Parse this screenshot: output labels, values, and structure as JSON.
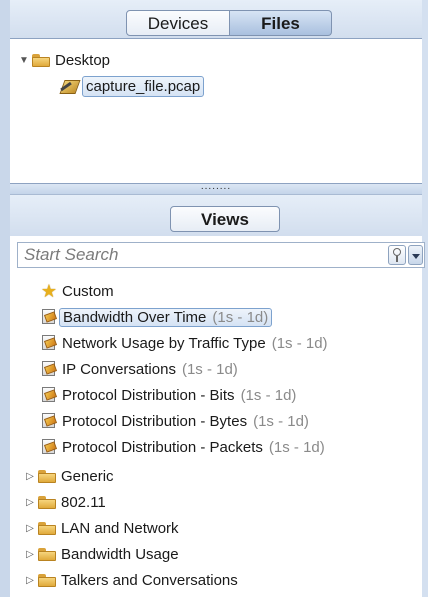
{
  "top_tabs": {
    "devices_label": "Devices",
    "files_label": "Files",
    "active": "Files"
  },
  "files_tree": {
    "root_label": "Desktop",
    "file_label": "capture_file.pcap"
  },
  "splitter": {
    "grip": "........"
  },
  "views": {
    "tab_label": "Views",
    "search": {
      "placeholder": "Start Search"
    },
    "custom_label": "Custom",
    "items": [
      {
        "label": "Bandwidth Over Time",
        "range": "(1s - 1d)",
        "selected": true
      },
      {
        "label": "Network Usage by Traffic Type",
        "range": "(1s - 1d)"
      },
      {
        "label": "IP Conversations",
        "range": "(1s - 1d)"
      },
      {
        "label": "Protocol Distribution - Bits",
        "range": "(1s - 1d)"
      },
      {
        "label": "Protocol Distribution - Bytes",
        "range": "(1s - 1d)"
      },
      {
        "label": "Protocol Distribution - Packets",
        "range": "(1s - 1d)"
      }
    ],
    "folders": [
      {
        "label": "Generic"
      },
      {
        "label": "802.11"
      },
      {
        "label": "LAN and Network"
      },
      {
        "label": "Bandwidth Usage"
      },
      {
        "label": "Talkers and Conversations"
      }
    ]
  },
  "icons": {
    "expanded": "triangle-down-icon",
    "collapsed": "triangle-right-icon",
    "folder": "folder-icon",
    "file": "capture-file-icon",
    "view": "report-view-icon",
    "custom": "star-icon",
    "search": "search-icon",
    "dropdown": "dropdown-arrow-icon"
  },
  "colors": {
    "frame": "#c9d7ea",
    "selection_fill": "#d5e3f4",
    "selection_border": "#7da2ce",
    "range_text": "#8a8a8a",
    "folder": "#e0aa3b"
  }
}
